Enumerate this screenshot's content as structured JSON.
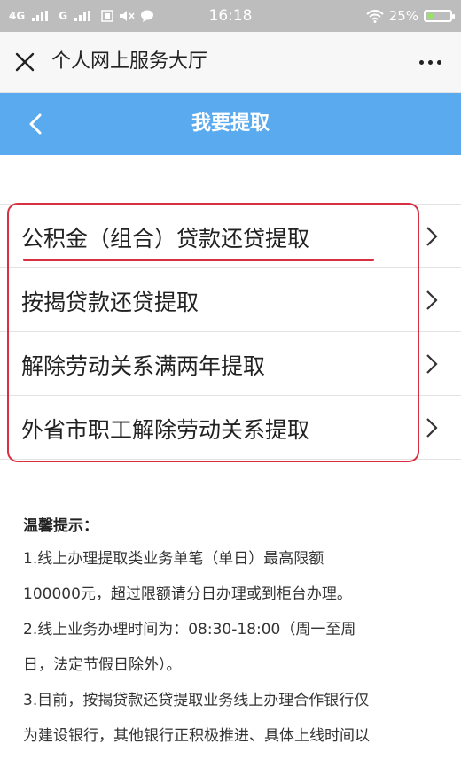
{
  "status_bar": {
    "network_1": "4G",
    "network_2": "G",
    "time": "16:18",
    "battery": "25%",
    "battery_level": 0.25
  },
  "title_bar": {
    "title": "个人网上服务大厅"
  },
  "nav_bar": {
    "title": "我要提取"
  },
  "menu": {
    "items": [
      {
        "label": "公积金（组合）贷款还贷提取"
      },
      {
        "label": "按揭贷款还贷提取"
      },
      {
        "label": "解除劳动关系满两年提取"
      },
      {
        "label": "外省市职工解除劳动关系提取"
      }
    ]
  },
  "tips": {
    "title": "温馨提示：",
    "lines": [
      "1.线上办理提取类业务单笔（单日）最高限额",
      "100000元，超过限额请分日办理或到柜台办理。",
      "2.线上业务办理时间为：08:30-18:00（周一至周",
      "日，法定节假日除外）。",
      "3.目前，按揭贷款还贷提取业务线上办理合作银行仅",
      "为建设银行，其他银行正积极推进、具体上线时间以"
    ]
  },
  "colors": {
    "nav_blue": "#5aaaf0",
    "annotation_red": "#d83040",
    "status_gray": "#bdbdbd"
  }
}
